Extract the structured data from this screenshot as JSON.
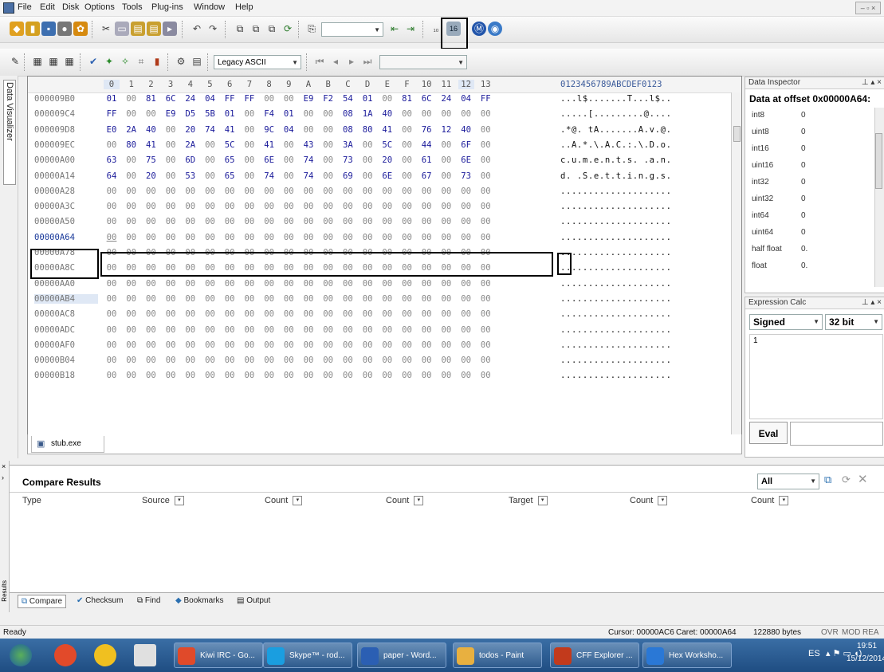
{
  "menu": [
    "File",
    "Edit",
    "Disk",
    "Options",
    "Tools",
    "Plug-ins",
    "Window",
    "Help"
  ],
  "toolbar2": {
    "encoding": "Legacy ASCII",
    "goto_value": ""
  },
  "vertical_tab": "Data Visualizer",
  "hex": {
    "columns": [
      "0",
      "1",
      "2",
      "3",
      "4",
      "5",
      "6",
      "7",
      "8",
      "9",
      "A",
      "B",
      "C",
      "D",
      "E",
      "F",
      "10",
      "11",
      "12",
      "13"
    ],
    "ascii_header": "0123456789ABCDEF0123",
    "rows": [
      {
        "addr": "000009B0",
        "bytes": [
          "01",
          "00",
          "81",
          "6C",
          "24",
          "04",
          "FF",
          "FF",
          "00",
          "00",
          "E9",
          "F2",
          "54",
          "01",
          "00",
          "81",
          "6C",
          "24",
          "04",
          "FF"
        ],
        "ascii": "...l$.......T...l$.."
      },
      {
        "addr": "000009C4",
        "bytes": [
          "FF",
          "00",
          "00",
          "E9",
          "D5",
          "5B",
          "01",
          "00",
          "F4",
          "01",
          "00",
          "00",
          "08",
          "1A",
          "40",
          "00",
          "00",
          "00",
          "00",
          "00"
        ],
        "ascii": ".....[.........@...."
      },
      {
        "addr": "000009D8",
        "bytes": [
          "E0",
          "2A",
          "40",
          "00",
          "20",
          "74",
          "41",
          "00",
          "9C",
          "04",
          "00",
          "00",
          "08",
          "80",
          "41",
          "00",
          "76",
          "12",
          "40",
          "00"
        ],
        "ascii": ".*@. tA.......A.v.@."
      },
      {
        "addr": "000009EC",
        "bytes": [
          "00",
          "80",
          "41",
          "00",
          "2A",
          "00",
          "5C",
          "00",
          "41",
          "00",
          "43",
          "00",
          "3A",
          "00",
          "5C",
          "00",
          "44",
          "00",
          "6F",
          "00"
        ],
        "ascii": "..A.*.\\.A.C.:.\\.D.o."
      },
      {
        "addr": "00000A00",
        "bytes": [
          "63",
          "00",
          "75",
          "00",
          "6D",
          "00",
          "65",
          "00",
          "6E",
          "00",
          "74",
          "00",
          "73",
          "00",
          "20",
          "00",
          "61",
          "00",
          "6E",
          "00"
        ],
        "ascii": "c.u.m.e.n.t.s. .a.n."
      },
      {
        "addr": "00000A14",
        "bytes": [
          "64",
          "00",
          "20",
          "00",
          "53",
          "00",
          "65",
          "00",
          "74",
          "00",
          "74",
          "00",
          "69",
          "00",
          "6E",
          "00",
          "67",
          "00",
          "73",
          "00"
        ],
        "ascii": "d. .S.e.t.t.i.n.g.s."
      },
      {
        "addr": "00000A28",
        "bytes": [
          "00",
          "00",
          "00",
          "00",
          "00",
          "00",
          "00",
          "00",
          "00",
          "00",
          "00",
          "00",
          "00",
          "00",
          "00",
          "00",
          "00",
          "00",
          "00",
          "00"
        ],
        "ascii": "...................."
      },
      {
        "addr": "00000A3C",
        "bytes": [
          "00",
          "00",
          "00",
          "00",
          "00",
          "00",
          "00",
          "00",
          "00",
          "00",
          "00",
          "00",
          "00",
          "00",
          "00",
          "00",
          "00",
          "00",
          "00",
          "00"
        ],
        "ascii": "...................."
      },
      {
        "addr": "00000A50",
        "bytes": [
          "00",
          "00",
          "00",
          "00",
          "00",
          "00",
          "00",
          "00",
          "00",
          "00",
          "00",
          "00",
          "00",
          "00",
          "00",
          "00",
          "00",
          "00",
          "00",
          "00"
        ],
        "ascii": "...................."
      },
      {
        "addr": "00000A64",
        "bytes": [
          "00",
          "00",
          "00",
          "00",
          "00",
          "00",
          "00",
          "00",
          "00",
          "00",
          "00",
          "00",
          "00",
          "00",
          "00",
          "00",
          "00",
          "00",
          "00",
          "00"
        ],
        "ascii": "...................."
      },
      {
        "addr": "00000A78",
        "bytes": [
          "00",
          "00",
          "00",
          "00",
          "00",
          "00",
          "00",
          "00",
          "00",
          "00",
          "00",
          "00",
          "00",
          "00",
          "00",
          "00",
          "00",
          "00",
          "00",
          "00"
        ],
        "ascii": "...................."
      },
      {
        "addr": "00000A8C",
        "bytes": [
          "00",
          "00",
          "00",
          "00",
          "00",
          "00",
          "00",
          "00",
          "00",
          "00",
          "00",
          "00",
          "00",
          "00",
          "00",
          "00",
          "00",
          "00",
          "00",
          "00"
        ],
        "ascii": "...................."
      },
      {
        "addr": "00000AA0",
        "bytes": [
          "00",
          "00",
          "00",
          "00",
          "00",
          "00",
          "00",
          "00",
          "00",
          "00",
          "00",
          "00",
          "00",
          "00",
          "00",
          "00",
          "00",
          "00",
          "00",
          "00"
        ],
        "ascii": "...................."
      },
      {
        "addr": "00000AB4",
        "bytes": [
          "00",
          "00",
          "00",
          "00",
          "00",
          "00",
          "00",
          "00",
          "00",
          "00",
          "00",
          "00",
          "00",
          "00",
          "00",
          "00",
          "00",
          "00",
          "00",
          "00"
        ],
        "ascii": "...................."
      },
      {
        "addr": "00000AC8",
        "bytes": [
          "00",
          "00",
          "00",
          "00",
          "00",
          "00",
          "00",
          "00",
          "00",
          "00",
          "00",
          "00",
          "00",
          "00",
          "00",
          "00",
          "00",
          "00",
          "00",
          "00"
        ],
        "ascii": "...................."
      },
      {
        "addr": "00000ADC",
        "bytes": [
          "00",
          "00",
          "00",
          "00",
          "00",
          "00",
          "00",
          "00",
          "00",
          "00",
          "00",
          "00",
          "00",
          "00",
          "00",
          "00",
          "00",
          "00",
          "00",
          "00"
        ],
        "ascii": "...................."
      },
      {
        "addr": "00000AF0",
        "bytes": [
          "00",
          "00",
          "00",
          "00",
          "00",
          "00",
          "00",
          "00",
          "00",
          "00",
          "00",
          "00",
          "00",
          "00",
          "00",
          "00",
          "00",
          "00",
          "00",
          "00"
        ],
        "ascii": "...................."
      },
      {
        "addr": "00000B04",
        "bytes": [
          "00",
          "00",
          "00",
          "00",
          "00",
          "00",
          "00",
          "00",
          "00",
          "00",
          "00",
          "00",
          "00",
          "00",
          "00",
          "00",
          "00",
          "00",
          "00",
          "00"
        ],
        "ascii": "...................."
      },
      {
        "addr": "00000B18",
        "bytes": [
          "00",
          "00",
          "00",
          "00",
          "00",
          "00",
          "00",
          "00",
          "00",
          "00",
          "00",
          "00",
          "00",
          "00",
          "00",
          "00",
          "00",
          "00",
          "00",
          "00"
        ],
        "ascii": "...................."
      }
    ]
  },
  "file_tab": "stub.exe",
  "data_inspector": {
    "title": "Data Inspector",
    "heading": "Data at offset 0x00000A64:",
    "rows": [
      {
        "type": "int8",
        "value": "0"
      },
      {
        "type": "uint8",
        "value": "0"
      },
      {
        "type": "int16",
        "value": "0"
      },
      {
        "type": "uint16",
        "value": "0"
      },
      {
        "type": "int32",
        "value": "0"
      },
      {
        "type": "uint32",
        "value": "0"
      },
      {
        "type": "int64",
        "value": "0"
      },
      {
        "type": "uint64",
        "value": "0"
      },
      {
        "type": "half float",
        "value": "0."
      },
      {
        "type": "float",
        "value": "0."
      }
    ]
  },
  "expr_calc": {
    "title": "Expression Calc",
    "mode": "Signed",
    "bits": "32 bit",
    "result": "1",
    "eval": "Eval"
  },
  "compare": {
    "title": "Compare Results",
    "filter": "All",
    "columns": [
      "Type",
      "Source",
      "Count",
      "Count",
      "Target",
      "Count",
      "Count"
    ]
  },
  "bottom_tabs": [
    "Compare",
    "Checksum",
    "Find",
    "Bookmarks",
    "Output"
  ],
  "side_label": "Results",
  "status": {
    "ready": "Ready",
    "cursor": "Cursor: 00000AC6",
    "caret": "Caret: 00000A64",
    "size": "122880 bytes",
    "ovr": "OVR",
    "mod": "MOD",
    "rea": "REA"
  },
  "taskbar": {
    "tasks": [
      {
        "label": "Kiwi IRC - Go...",
        "color": "#e04a2a"
      },
      {
        "label": "Skype™ - rod...",
        "color": "#1a9ee0"
      },
      {
        "label": "paper - Word...",
        "color": "#2b5fb3"
      },
      {
        "label": "todos - Paint",
        "color": "#e8b040"
      },
      {
        "label": "CFF Explorer ...",
        "color": "#c23a1c"
      },
      {
        "label": "Hex Worksho...",
        "color": "#2a78d6"
      }
    ],
    "lang": "ES",
    "time": "19:51",
    "date": "15/12/2014"
  }
}
